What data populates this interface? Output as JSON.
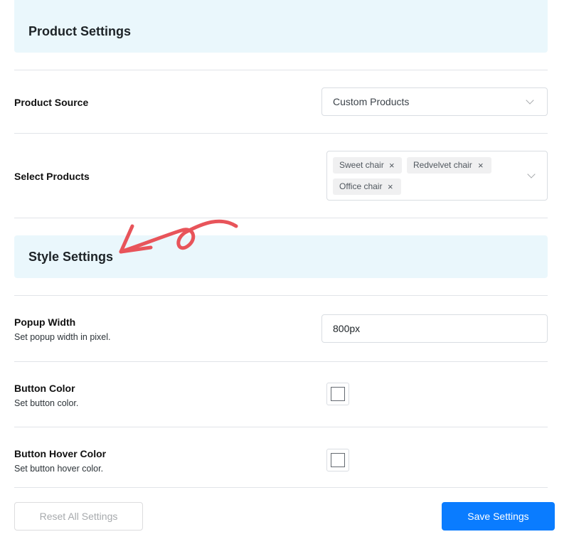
{
  "product_settings": {
    "title": "Product Settings",
    "product_source": {
      "label": "Product Source",
      "selected": "Custom Products"
    },
    "select_products": {
      "label": "Select Products",
      "tags": [
        "Sweet chair",
        "Redvelvet chair",
        "Office chair"
      ],
      "remove_glyph": "×"
    }
  },
  "style_settings": {
    "title": "Style Settings",
    "popup_width": {
      "label": "Popup Width",
      "description": "Set popup width in pixel.",
      "value": "800px"
    },
    "button_color": {
      "label": "Button Color",
      "description": "Set button color.",
      "color": "#ffffff"
    },
    "button_hover_color": {
      "label": "Button Hover Color",
      "description": "Set button hover color.",
      "color": "#ffffff"
    }
  },
  "footer": {
    "reset_label": "Reset All Settings",
    "save_label": "Save Settings"
  },
  "colors": {
    "accent": "#0a7cff",
    "section_header_bg": "#eaf7fc",
    "annotation_arrow": "#e8545a"
  },
  "icons": {
    "dropdown": "chevron-down-icon",
    "remove_tag": "close-icon",
    "annotation": "arrow-annotation-icon"
  }
}
